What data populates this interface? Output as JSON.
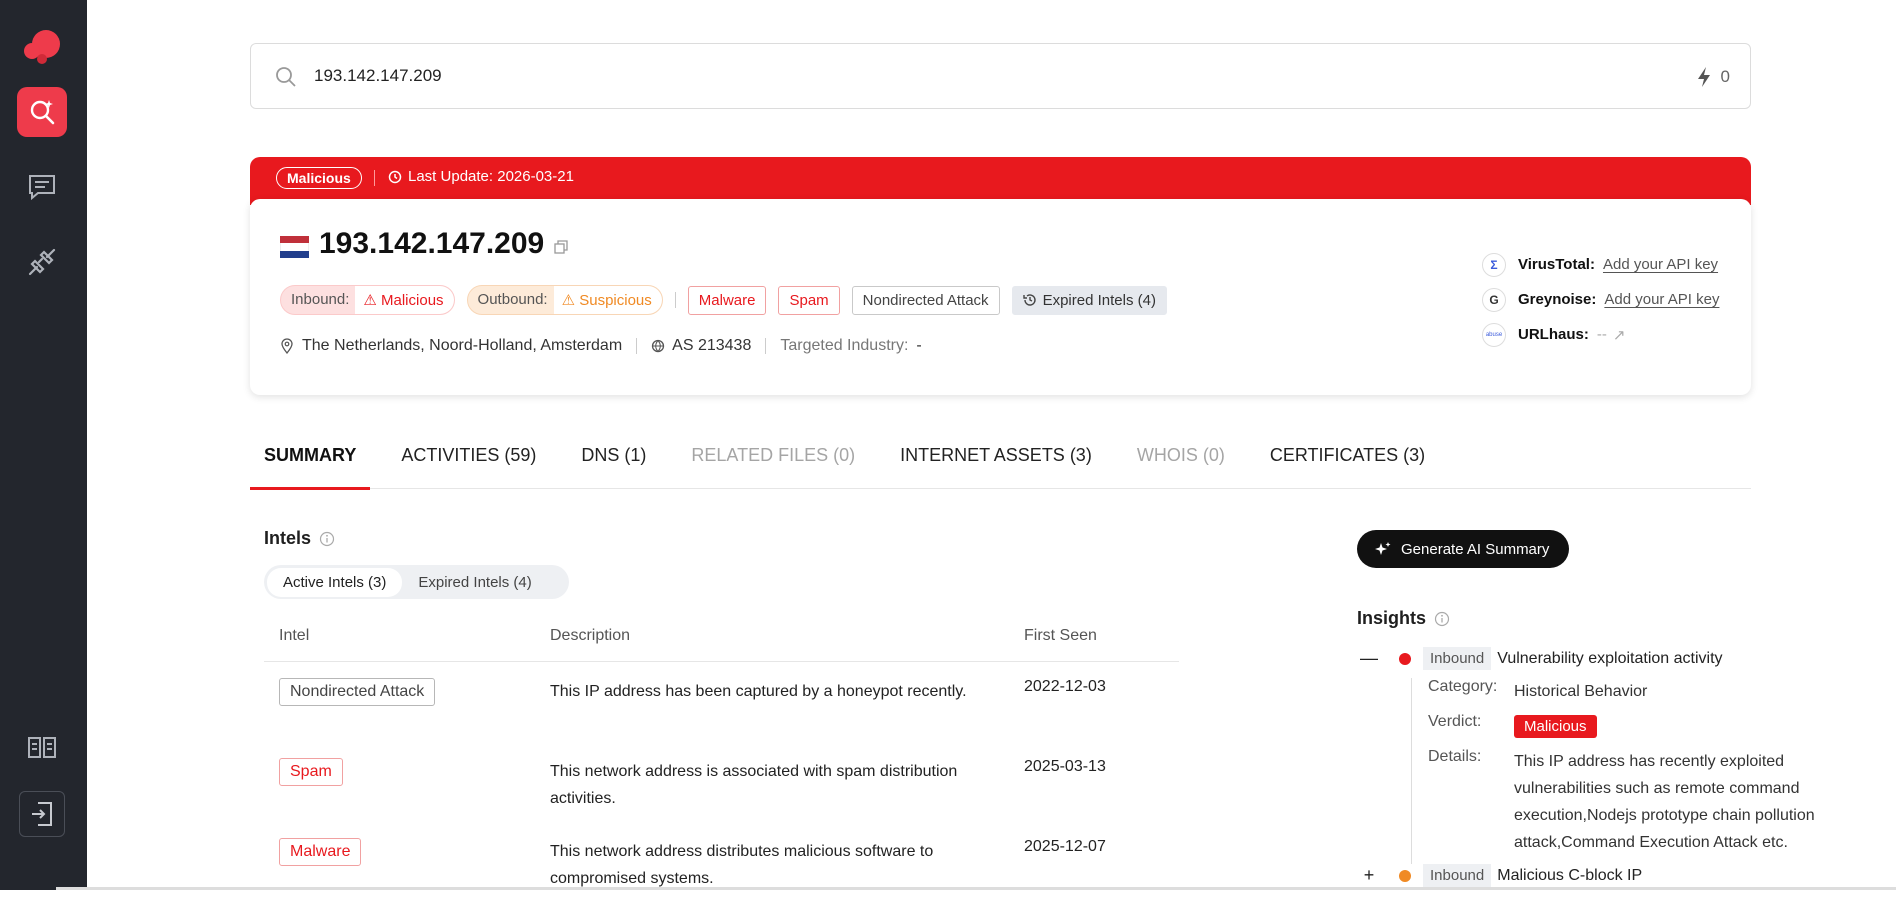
{
  "search": {
    "value": "193.142.147.209",
    "credits": "0"
  },
  "banner": {
    "verdict": "Malicious",
    "last_update": "Last Update: 2026-03-21"
  },
  "header": {
    "ip": "193.142.147.209",
    "inbound_label": "Inbound:",
    "inbound_value": "Malicious",
    "outbound_label": "Outbound:",
    "outbound_value": "Suspicious",
    "tags": [
      "Malware",
      "Spam",
      "Nondirected Attack"
    ],
    "expired": "Expired Intels (4)",
    "location": "The Netherlands, Noord-Holland, Amsterdam",
    "asn": "AS 213438",
    "industry_label": "Targeted Industry:",
    "industry_value": "-"
  },
  "integrations": [
    {
      "name": "VirusTotal:",
      "value": "Add your API key"
    },
    {
      "name": "Greynoise:",
      "value": "Add your API key"
    },
    {
      "name": "URLhaus:",
      "value": "--"
    }
  ],
  "tabs": [
    "SUMMARY",
    "ACTIVITIES (59)",
    "DNS (1)",
    "RELATED FILES (0)",
    "INTERNET ASSETS (3)",
    "WHOIS (0)",
    "CERTIFICATES (3)"
  ],
  "intels": {
    "title": "Intels",
    "seg_active": "Active Intels (3)",
    "seg_expired": "Expired Intels (4)",
    "columns": [
      "Intel",
      "Description",
      "First Seen"
    ],
    "rows": [
      {
        "intel": "Nondirected Attack",
        "desc": "This IP address has been captured by a honeypot recently.",
        "date": "2022-12-03"
      },
      {
        "intel": "Spam",
        "desc": "This network address is associated with spam distribution activities.",
        "date": "2025-03-13"
      },
      {
        "intel": "Malware",
        "desc": "This network address distributes malicious software to compromised systems.",
        "date": "2025-12-07"
      }
    ]
  },
  "ai_button": "Generate AI Summary",
  "insights": {
    "title": "Insights",
    "items": [
      {
        "toggle": "—",
        "dir": "Inbound",
        "text": "Vulnerability exploitation activity",
        "color": "#e8191e"
      },
      {
        "toggle": "+",
        "dir": "Inbound",
        "text": "Malicious C-block IP",
        "color": "#f08a24"
      }
    ],
    "detail": {
      "category_label": "Category:",
      "category": "Historical Behavior",
      "verdict_label": "Verdict:",
      "verdict": "Malicious",
      "details_label": "Details:",
      "details": "This IP address has recently exploited vulnerabilities such as remote command execution,Nodejs prototype chain pollution attack,Command Execution Attack etc."
    }
  }
}
